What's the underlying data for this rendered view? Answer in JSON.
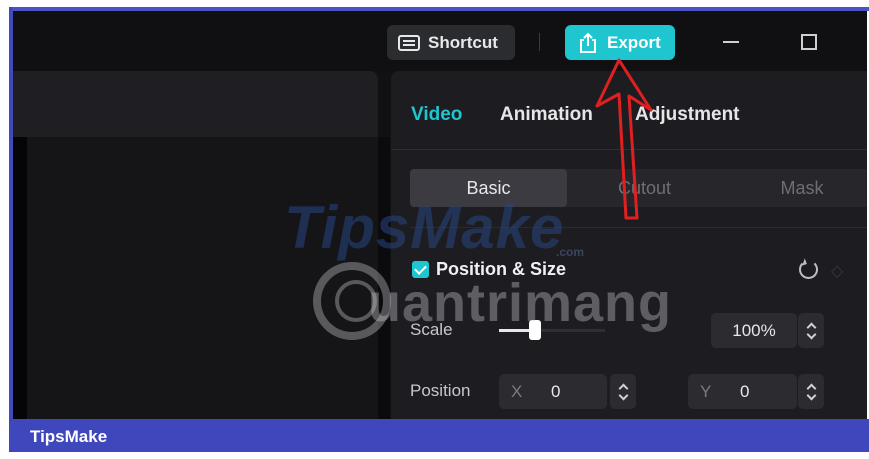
{
  "titlebar": {
    "shortcut_label": "Shortcut",
    "export_label": "Export",
    "icons": [
      "keyboard-icon",
      "export-icon",
      "minimize-icon",
      "maximize-icon"
    ]
  },
  "panel": {
    "tabs": [
      {
        "label": "Video",
        "active": true
      },
      {
        "label": "Animation",
        "active": false
      },
      {
        "label": "Adjustment",
        "active": false
      }
    ],
    "subtabs": [
      {
        "label": "Basic",
        "active": true
      },
      {
        "label": "Cutout",
        "active": false
      },
      {
        "label": "Mask",
        "active": false
      }
    ],
    "section": {
      "title": "Position & Size",
      "checked": true
    },
    "scale": {
      "label": "Scale",
      "value": "100%",
      "slider_fraction": 0.35
    },
    "position": {
      "label": "Position",
      "x_axis": "X",
      "x_value": "0",
      "y_axis": "Y",
      "y_value": "0"
    }
  },
  "watermark": {
    "brand_1": "TipsMake",
    "brand_1_suffix": ".com",
    "brand_2": "uantrimang"
  },
  "footer": {
    "label": "TipsMake"
  },
  "colors": {
    "accent": "#1fc6d0",
    "footer": "#3e47bc",
    "annotation": "#e02020"
  }
}
